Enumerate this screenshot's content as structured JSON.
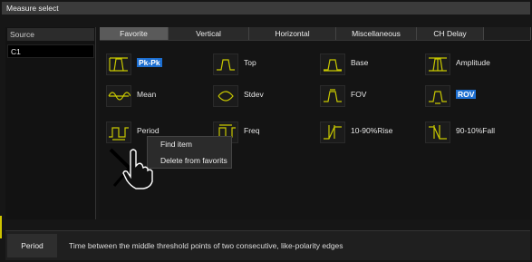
{
  "title": "Measure select",
  "source": {
    "label": "Source",
    "items": [
      "C1"
    ]
  },
  "tabs": [
    {
      "label": "Favorite",
      "active": true
    },
    {
      "label": "Vertical",
      "active": false
    },
    {
      "label": "Horizontal",
      "active": false
    },
    {
      "label": "Miscellaneous",
      "active": false
    },
    {
      "label": "CH Delay",
      "active": false
    }
  ],
  "measurements": [
    {
      "label": "Pk-Pk",
      "selected": true,
      "icon": "pk-pk-icon"
    },
    {
      "label": "Top",
      "selected": false,
      "icon": "top-icon"
    },
    {
      "label": "Base",
      "selected": false,
      "icon": "base-icon"
    },
    {
      "label": "Amplitude",
      "selected": false,
      "icon": "amplitude-icon"
    },
    {
      "label": "Mean",
      "selected": false,
      "icon": "mean-icon"
    },
    {
      "label": "Stdev",
      "selected": false,
      "icon": "stdev-icon"
    },
    {
      "label": "FOV",
      "selected": false,
      "icon": "fov-icon"
    },
    {
      "label": "ROV",
      "selected": true,
      "icon": "rov-icon"
    },
    {
      "label": "Period",
      "selected": false,
      "icon": "period-icon"
    },
    {
      "label": "Freq",
      "selected": false,
      "icon": "freq-icon"
    },
    {
      "label": "10-90%Rise",
      "selected": false,
      "icon": "rise-icon"
    },
    {
      "label": "90-10%Fall",
      "selected": false,
      "icon": "fall-icon"
    }
  ],
  "context_menu": {
    "items": [
      "Find item",
      "Delete from favorits"
    ]
  },
  "footer": {
    "name": "Period",
    "description": "Time between the middle threshold points of two consecutive, like-polarity edges"
  },
  "colors": {
    "accent": "#1d6fd1",
    "waveform": "#c8c800",
    "background": "#141414"
  }
}
